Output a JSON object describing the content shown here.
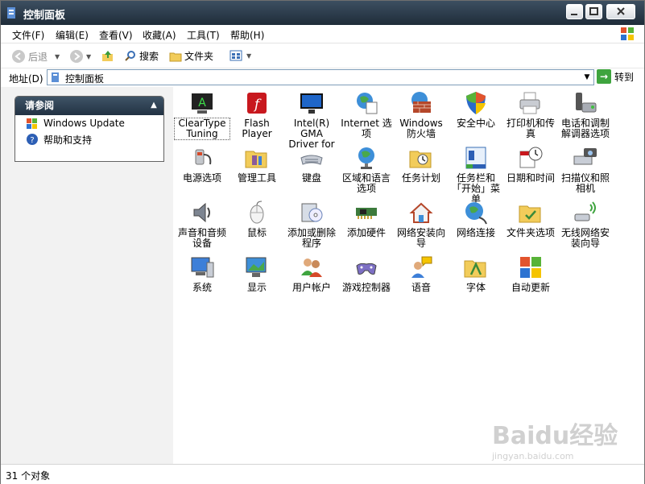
{
  "window": {
    "title": "控制面板"
  },
  "menu": [
    {
      "label": "文件(F)"
    },
    {
      "label": "编辑(E)"
    },
    {
      "label": "查看(V)"
    },
    {
      "label": "收藏(A)"
    },
    {
      "label": "工具(T)"
    },
    {
      "label": "帮助(H)"
    }
  ],
  "toolbar": {
    "back_label": "后退",
    "search_label": "搜索",
    "folders_label": "文件夹"
  },
  "address": {
    "label": "地址(D)",
    "value": "控制面板",
    "go_label": "转到"
  },
  "sidebar": {
    "panel_title": "请参阅",
    "links": [
      {
        "label": "Windows Update",
        "icon": "windows-update-icon"
      },
      {
        "label": "帮助和支持",
        "icon": "help-icon"
      }
    ]
  },
  "items": [
    {
      "label": "ClearType Tuning",
      "icon": "cleartype-icon"
    },
    {
      "label": "Flash Player",
      "icon": "flash-player-icon"
    },
    {
      "label": "Intel(R) GMA Driver for ...",
      "icon": "intel-gma-icon"
    },
    {
      "label": "Internet 选项",
      "icon": "internet-options-icon"
    },
    {
      "label": "Windows 防火墙",
      "icon": "firewall-icon"
    },
    {
      "label": "安全中心",
      "icon": "security-center-icon"
    },
    {
      "label": "打印机和传真",
      "icon": "printer-icon"
    },
    {
      "label": "电话和调制解调器选项",
      "icon": "phone-modem-icon"
    },
    {
      "label": "电源选项",
      "icon": "power-icon"
    },
    {
      "label": "管理工具",
      "icon": "admin-tools-icon"
    },
    {
      "label": "键盘",
      "icon": "keyboard-icon"
    },
    {
      "label": "区域和语言选项",
      "icon": "region-language-icon"
    },
    {
      "label": "任务计划",
      "icon": "scheduled-tasks-icon"
    },
    {
      "label": "任务栏和「开始」菜单",
      "icon": "taskbar-icon"
    },
    {
      "label": "日期和时间",
      "icon": "date-time-icon"
    },
    {
      "label": "扫描仪和照相机",
      "icon": "scanner-camera-icon"
    },
    {
      "label": "声音和音频设备",
      "icon": "sound-icon"
    },
    {
      "label": "鼠标",
      "icon": "mouse-icon"
    },
    {
      "label": "添加或删除程序",
      "icon": "add-remove-programs-icon"
    },
    {
      "label": "添加硬件",
      "icon": "add-hardware-icon"
    },
    {
      "label": "网络安装向导",
      "icon": "network-setup-icon"
    },
    {
      "label": "网络连接",
      "icon": "network-connections-icon"
    },
    {
      "label": "文件夹选项",
      "icon": "folder-options-icon"
    },
    {
      "label": "无线网络安装向导",
      "icon": "wireless-setup-icon"
    },
    {
      "label": "系统",
      "icon": "system-icon"
    },
    {
      "label": "显示",
      "icon": "display-icon"
    },
    {
      "label": "用户帐户",
      "icon": "user-accounts-icon"
    },
    {
      "label": "游戏控制器",
      "icon": "game-controllers-icon"
    },
    {
      "label": "语音",
      "icon": "speech-icon"
    },
    {
      "label": "字体",
      "icon": "fonts-icon"
    },
    {
      "label": "自动更新",
      "icon": "automatic-updates-icon"
    }
  ],
  "status": {
    "text": "31 个对象"
  },
  "watermark": {
    "brand": "Baidu经验",
    "url": "jingyan.baidu.com"
  }
}
